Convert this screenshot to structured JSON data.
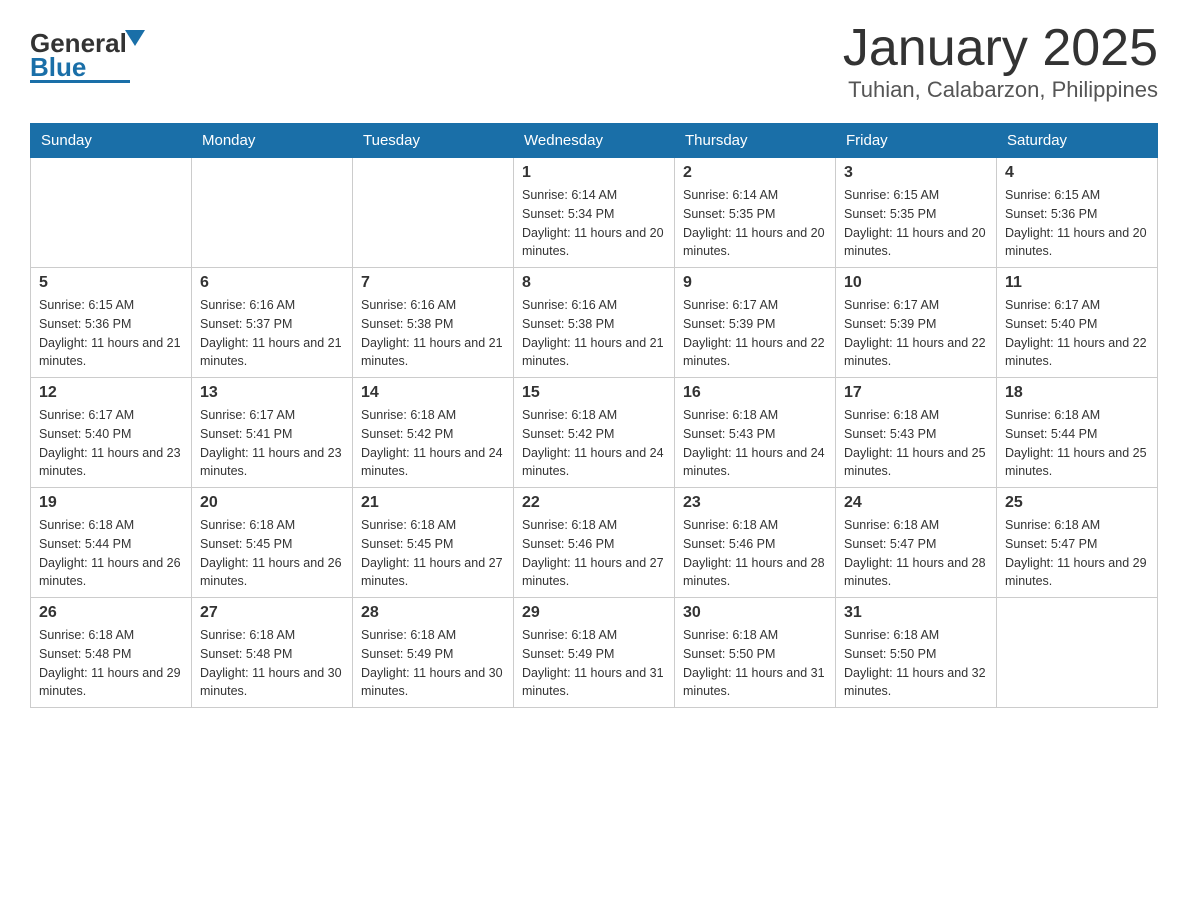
{
  "header": {
    "logo_general": "General",
    "logo_blue": "Blue",
    "title": "January 2025",
    "subtitle": "Tuhian, Calabarzon, Philippines"
  },
  "days_of_week": [
    "Sunday",
    "Monday",
    "Tuesday",
    "Wednesday",
    "Thursday",
    "Friday",
    "Saturday"
  ],
  "weeks": [
    {
      "days": [
        {
          "num": "",
          "info": ""
        },
        {
          "num": "",
          "info": ""
        },
        {
          "num": "",
          "info": ""
        },
        {
          "num": "1",
          "info": "Sunrise: 6:14 AM\nSunset: 5:34 PM\nDaylight: 11 hours and 20 minutes."
        },
        {
          "num": "2",
          "info": "Sunrise: 6:14 AM\nSunset: 5:35 PM\nDaylight: 11 hours and 20 minutes."
        },
        {
          "num": "3",
          "info": "Sunrise: 6:15 AM\nSunset: 5:35 PM\nDaylight: 11 hours and 20 minutes."
        },
        {
          "num": "4",
          "info": "Sunrise: 6:15 AM\nSunset: 5:36 PM\nDaylight: 11 hours and 20 minutes."
        }
      ]
    },
    {
      "days": [
        {
          "num": "5",
          "info": "Sunrise: 6:15 AM\nSunset: 5:36 PM\nDaylight: 11 hours and 21 minutes."
        },
        {
          "num": "6",
          "info": "Sunrise: 6:16 AM\nSunset: 5:37 PM\nDaylight: 11 hours and 21 minutes."
        },
        {
          "num": "7",
          "info": "Sunrise: 6:16 AM\nSunset: 5:38 PM\nDaylight: 11 hours and 21 minutes."
        },
        {
          "num": "8",
          "info": "Sunrise: 6:16 AM\nSunset: 5:38 PM\nDaylight: 11 hours and 21 minutes."
        },
        {
          "num": "9",
          "info": "Sunrise: 6:17 AM\nSunset: 5:39 PM\nDaylight: 11 hours and 22 minutes."
        },
        {
          "num": "10",
          "info": "Sunrise: 6:17 AM\nSunset: 5:39 PM\nDaylight: 11 hours and 22 minutes."
        },
        {
          "num": "11",
          "info": "Sunrise: 6:17 AM\nSunset: 5:40 PM\nDaylight: 11 hours and 22 minutes."
        }
      ]
    },
    {
      "days": [
        {
          "num": "12",
          "info": "Sunrise: 6:17 AM\nSunset: 5:40 PM\nDaylight: 11 hours and 23 minutes."
        },
        {
          "num": "13",
          "info": "Sunrise: 6:17 AM\nSunset: 5:41 PM\nDaylight: 11 hours and 23 minutes."
        },
        {
          "num": "14",
          "info": "Sunrise: 6:18 AM\nSunset: 5:42 PM\nDaylight: 11 hours and 24 minutes."
        },
        {
          "num": "15",
          "info": "Sunrise: 6:18 AM\nSunset: 5:42 PM\nDaylight: 11 hours and 24 minutes."
        },
        {
          "num": "16",
          "info": "Sunrise: 6:18 AM\nSunset: 5:43 PM\nDaylight: 11 hours and 24 minutes."
        },
        {
          "num": "17",
          "info": "Sunrise: 6:18 AM\nSunset: 5:43 PM\nDaylight: 11 hours and 25 minutes."
        },
        {
          "num": "18",
          "info": "Sunrise: 6:18 AM\nSunset: 5:44 PM\nDaylight: 11 hours and 25 minutes."
        }
      ]
    },
    {
      "days": [
        {
          "num": "19",
          "info": "Sunrise: 6:18 AM\nSunset: 5:44 PM\nDaylight: 11 hours and 26 minutes."
        },
        {
          "num": "20",
          "info": "Sunrise: 6:18 AM\nSunset: 5:45 PM\nDaylight: 11 hours and 26 minutes."
        },
        {
          "num": "21",
          "info": "Sunrise: 6:18 AM\nSunset: 5:45 PM\nDaylight: 11 hours and 27 minutes."
        },
        {
          "num": "22",
          "info": "Sunrise: 6:18 AM\nSunset: 5:46 PM\nDaylight: 11 hours and 27 minutes."
        },
        {
          "num": "23",
          "info": "Sunrise: 6:18 AM\nSunset: 5:46 PM\nDaylight: 11 hours and 28 minutes."
        },
        {
          "num": "24",
          "info": "Sunrise: 6:18 AM\nSunset: 5:47 PM\nDaylight: 11 hours and 28 minutes."
        },
        {
          "num": "25",
          "info": "Sunrise: 6:18 AM\nSunset: 5:47 PM\nDaylight: 11 hours and 29 minutes."
        }
      ]
    },
    {
      "days": [
        {
          "num": "26",
          "info": "Sunrise: 6:18 AM\nSunset: 5:48 PM\nDaylight: 11 hours and 29 minutes."
        },
        {
          "num": "27",
          "info": "Sunrise: 6:18 AM\nSunset: 5:48 PM\nDaylight: 11 hours and 30 minutes."
        },
        {
          "num": "28",
          "info": "Sunrise: 6:18 AM\nSunset: 5:49 PM\nDaylight: 11 hours and 30 minutes."
        },
        {
          "num": "29",
          "info": "Sunrise: 6:18 AM\nSunset: 5:49 PM\nDaylight: 11 hours and 31 minutes."
        },
        {
          "num": "30",
          "info": "Sunrise: 6:18 AM\nSunset: 5:50 PM\nDaylight: 11 hours and 31 minutes."
        },
        {
          "num": "31",
          "info": "Sunrise: 6:18 AM\nSunset: 5:50 PM\nDaylight: 11 hours and 32 minutes."
        },
        {
          "num": "",
          "info": ""
        }
      ]
    }
  ]
}
